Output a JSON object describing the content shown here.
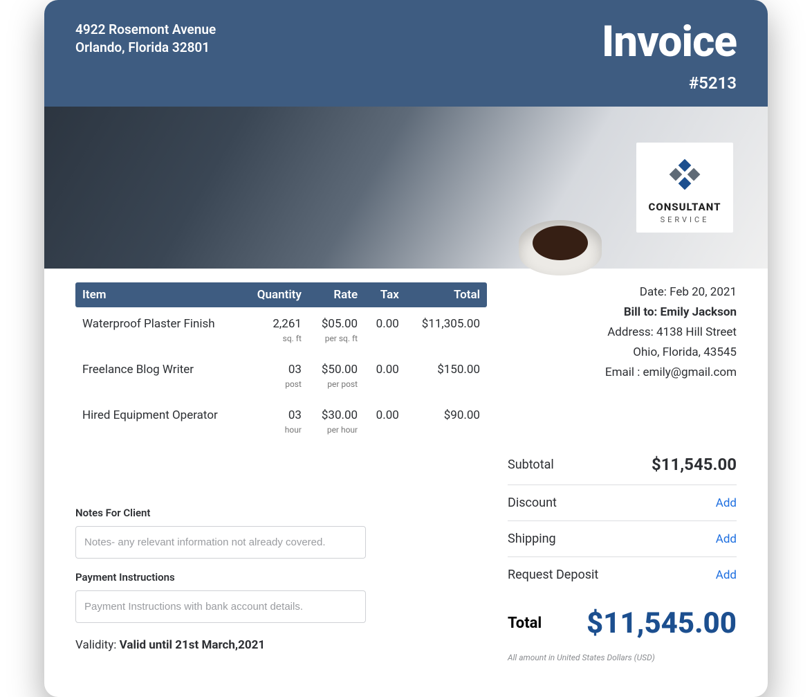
{
  "header": {
    "address_line1": "4922 Rosemont Avenue",
    "address_line2": "Orlando, Florida 32801",
    "title": "Invoice",
    "number": "#5213"
  },
  "logo": {
    "name": "CONSULTANT",
    "sub": "SERVICE"
  },
  "table": {
    "headers": {
      "item": "Item",
      "qty": "Quantity",
      "rate": "Rate",
      "tax": "Tax",
      "total": "Total"
    },
    "rows": [
      {
        "item": "Waterproof Plaster Finish",
        "qty": "2,261",
        "qty_unit": "sq. ft",
        "rate": "$05.00",
        "rate_unit": "per sq. ft",
        "tax": "0.00",
        "total": "$11,305.00"
      },
      {
        "item": "Freelance Blog Writer",
        "qty": "03",
        "qty_unit": "post",
        "rate": "$50.00",
        "rate_unit": "per post",
        "tax": "0.00",
        "total": "$150.00"
      },
      {
        "item": "Hired Equipment Operator",
        "qty": "03",
        "qty_unit": "hour",
        "rate": "$30.00",
        "rate_unit": "per hour",
        "tax": "0.00",
        "total": "$90.00"
      }
    ]
  },
  "billing": {
    "date_label": "Date: ",
    "date": "Feb 20, 2021",
    "bill_to_label": "Bill to: ",
    "bill_to": "Emily Jackson",
    "address_label": "Address: ",
    "address_line1": "4138 Hill Street",
    "address_line2": "Ohio, Florida, 43545",
    "email_label": "Email : ",
    "email": "emily@gmail.com"
  },
  "summary": {
    "subtotal_label": "Subtotal",
    "subtotal": "$11,545.00",
    "discount_label": "Discount",
    "discount_action": "Add",
    "shipping_label": "Shipping",
    "shipping_action": "Add",
    "deposit_label": "Request Deposit",
    "deposit_action": "Add",
    "total_label": "Total",
    "total": "$11,545.00",
    "currency_note": "All amount in United States Dollars (USD)"
  },
  "notes": {
    "notes_label": "Notes For Client",
    "notes_placeholder": "Notes- any relevant information not already covered.",
    "payment_label": "Payment Instructions",
    "payment_placeholder": "Payment Instructions with bank account details.",
    "validity_label": "Validity: ",
    "validity_value": "Valid until 21st March,2021"
  }
}
